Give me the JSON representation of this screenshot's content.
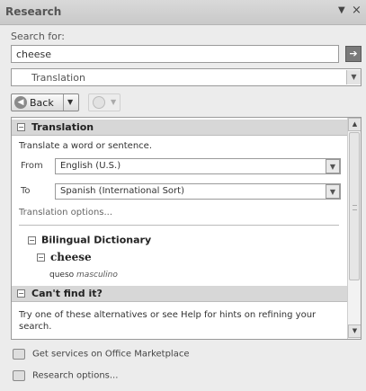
{
  "pane": {
    "title": "Research",
    "dropdown_glyph": "▼",
    "close_glyph": "×"
  },
  "search": {
    "label": "Search for:",
    "value": "cheese",
    "go_glyph": "➔",
    "service": "Translation"
  },
  "nav": {
    "back_label": "Back",
    "back_icon": "arrow-left-icon",
    "forward_icon": "arrow-right-icon"
  },
  "translation": {
    "header": "Translation",
    "description": "Translate a word or sentence.",
    "from_label": "From",
    "from_value": "English (U.S.)",
    "to_label": "To",
    "to_value": "Spanish (International Sort)",
    "options_link": "Translation options..."
  },
  "dictionary": {
    "header": "Bilingual Dictionary",
    "word": "cheese",
    "translation_word": "queso",
    "translation_gender": "masculino"
  },
  "cant_find": {
    "header": "Can't find it?",
    "text_line1": "Try one of these alternatives or see Help for hints on refining your",
    "text_line2": "search."
  },
  "footer": {
    "marketplace": "Get services on Office Marketplace",
    "options": "Research options..."
  }
}
